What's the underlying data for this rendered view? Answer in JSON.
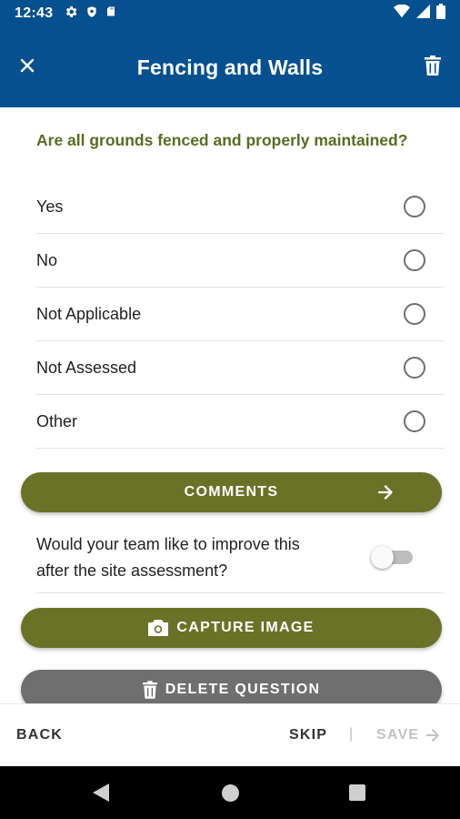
{
  "status_bar": {
    "time": "12:43",
    "left_icons": [
      "gear-icon",
      "shield-icon",
      "sd-card-icon"
    ],
    "right_icons": [
      "wifi-icon",
      "signal-icon",
      "battery-icon"
    ]
  },
  "app_bar": {
    "title": "Fencing and Walls",
    "close_icon": "close-icon",
    "delete_icon": "trash-icon",
    "background_color": "#07508f"
  },
  "question": {
    "text": "Are all grounds fenced and properly maintained?",
    "color": "#5a6b23",
    "options": [
      {
        "label": "Yes",
        "selected": false
      },
      {
        "label": "No",
        "selected": false
      },
      {
        "label": "Not Applicable",
        "selected": false
      },
      {
        "label": "Not Assessed",
        "selected": false
      },
      {
        "label": "Other",
        "selected": false
      }
    ]
  },
  "comments_button": {
    "label": "COMMENTS",
    "icon": "arrow-right-icon",
    "color": "#6a7228"
  },
  "improve": {
    "text": "Would your team like to improve this after the site assessment?",
    "toggle_on": false
  },
  "capture_button": {
    "label": "CAPTURE IMAGE",
    "icon": "camera-icon",
    "color": "#6a7228"
  },
  "delete_button": {
    "label": "DELETE QUESTION",
    "icon": "trash-icon",
    "color": "#6f6f70"
  },
  "footer": {
    "back_label": "BACK",
    "skip_label": "SKIP",
    "divider": "|",
    "save_label": "SAVE",
    "save_icon": "arrow-right-icon"
  },
  "nav_bar": {
    "icons": [
      "back-triangle-icon",
      "home-circle-icon",
      "recents-square-icon"
    ]
  }
}
